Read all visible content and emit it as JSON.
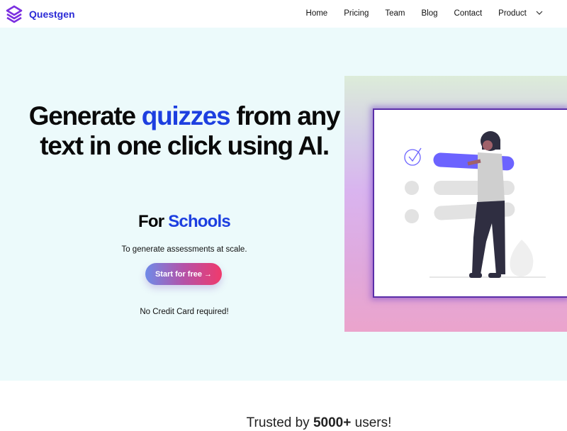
{
  "nav": {
    "brand": "Questgen",
    "links": [
      "Home",
      "Pricing",
      "Team",
      "Blog",
      "Contact",
      "Product"
    ]
  },
  "hero": {
    "headline_1": "Generate ",
    "headline_highlight": "quizzes",
    "headline_2": " from any text in one click using AI.",
    "for_label": "For",
    "for_highlight": "Schools",
    "subtitle": "To generate assessments at scale.",
    "cta": "Start for free →",
    "note": "No Credit Card required!"
  },
  "trusted": {
    "prefix": "Trusted by ",
    "count": "5000+",
    "suffix": " users!"
  },
  "colors": {
    "accent": "#1d3fe0",
    "brand": "#2b2bd6",
    "hero_bg": "#ecfafb",
    "illustration_bar": "#6c63ff"
  }
}
